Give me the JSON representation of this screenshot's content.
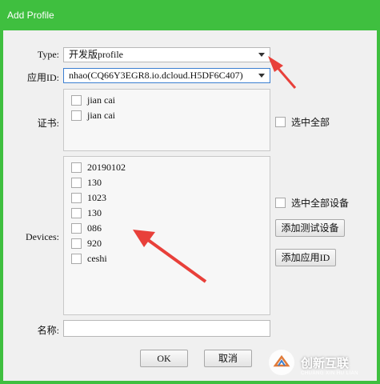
{
  "window": {
    "title": "Add Profile"
  },
  "form": {
    "type_label": "Type:",
    "type_value": "开发版profile",
    "appid_label": "应用ID:",
    "appid_value": "nhao(CQ66Y3EGR8.io.dcloud.H5DF6C407)",
    "cert_label": "证书:",
    "certificates": [
      "jian cai",
      "jian cai"
    ],
    "select_all_certs": "选中全部",
    "devices_label": "Devices:",
    "devices": [
      "20190102",
      "130",
      "1023",
      "130",
      "086",
      "920",
      "ceshi"
    ],
    "select_all_devices": "选中全部设备",
    "add_test_device": "添加测试设备",
    "add_app_id": "添加应用ID",
    "name_label": "名称:",
    "name_value": ""
  },
  "buttons": {
    "ok": "OK",
    "cancel": "取消"
  },
  "watermark": {
    "text": "创新互联",
    "subtext": "CHUANG XIN HU LIAN"
  },
  "colors": {
    "title_bar": "#3fbf3f",
    "annotation_arrow": "#e8403a"
  }
}
